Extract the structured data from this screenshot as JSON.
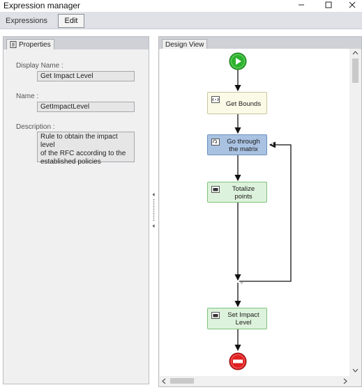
{
  "window": {
    "title": "Expression manager"
  },
  "toolbar": {
    "tabs": [
      {
        "label": "Expressions",
        "active": false
      },
      {
        "label": "Edit",
        "active": true
      }
    ]
  },
  "properties_panel": {
    "tab_label": "Properties",
    "tab_icon": "properties-sheet-icon",
    "fields": {
      "display_name": {
        "label": "Display Name :",
        "value": "Get Impact Level"
      },
      "name": {
        "label": "Name :",
        "value": "GetImpactLevel"
      },
      "description": {
        "label": "Description :",
        "lines": [
          "Rule to obtain the impact level",
          "of the RFC according to the",
          "established policies"
        ]
      }
    }
  },
  "design_view": {
    "tab_label": "Design View",
    "activities": {
      "get_bounds": {
        "label": "Get Bounds",
        "icon": "code-activity-icon"
      },
      "go_through": {
        "label_line1": "Go through",
        "label_line2": "the matrix",
        "icon": "loop-activity-icon"
      },
      "totalize": {
        "label_line1": "Totalize",
        "label_line2": "points",
        "icon": "assign-activity-icon"
      },
      "set_impact": {
        "label_line1": "Set Impact",
        "label_line2": "Level",
        "icon": "assign-activity-icon"
      }
    },
    "start_node_icon": "play-start-icon",
    "end_node_icon": "stop-end-icon"
  },
  "colors": {
    "start_green": "#2db22d",
    "end_red": "#e02020",
    "code_fill": "#fbfae7",
    "code_border": "#c9c59a",
    "loop_fill": "#a9c2e2",
    "loop_border": "#6a8fbf",
    "assign_fill": "#ddf2dc",
    "assign_border": "#7dc27a"
  }
}
